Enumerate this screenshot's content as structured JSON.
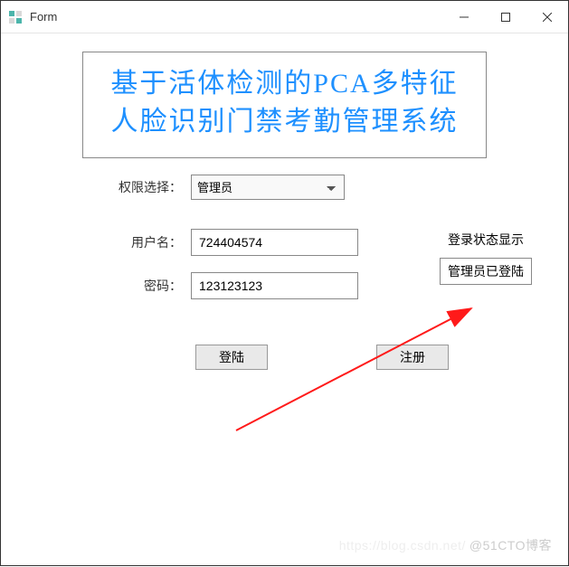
{
  "window": {
    "title": "Form"
  },
  "banner": {
    "title": "基于活体检测的PCA多特征人脸识别门禁考勤管理系统"
  },
  "form": {
    "role_label": "权限选择：",
    "role_selected": "管理员",
    "username_label": "用户名：",
    "username_value": "724404574",
    "password_label": "密码：",
    "password_value": "123123123"
  },
  "status": {
    "heading": "登录状态显示",
    "value": "管理员已登陆"
  },
  "buttons": {
    "login": "登陆",
    "register": "注册"
  },
  "watermark": {
    "faint": "https://blog.csdn.net/",
    "text": "@51CTO博客"
  }
}
